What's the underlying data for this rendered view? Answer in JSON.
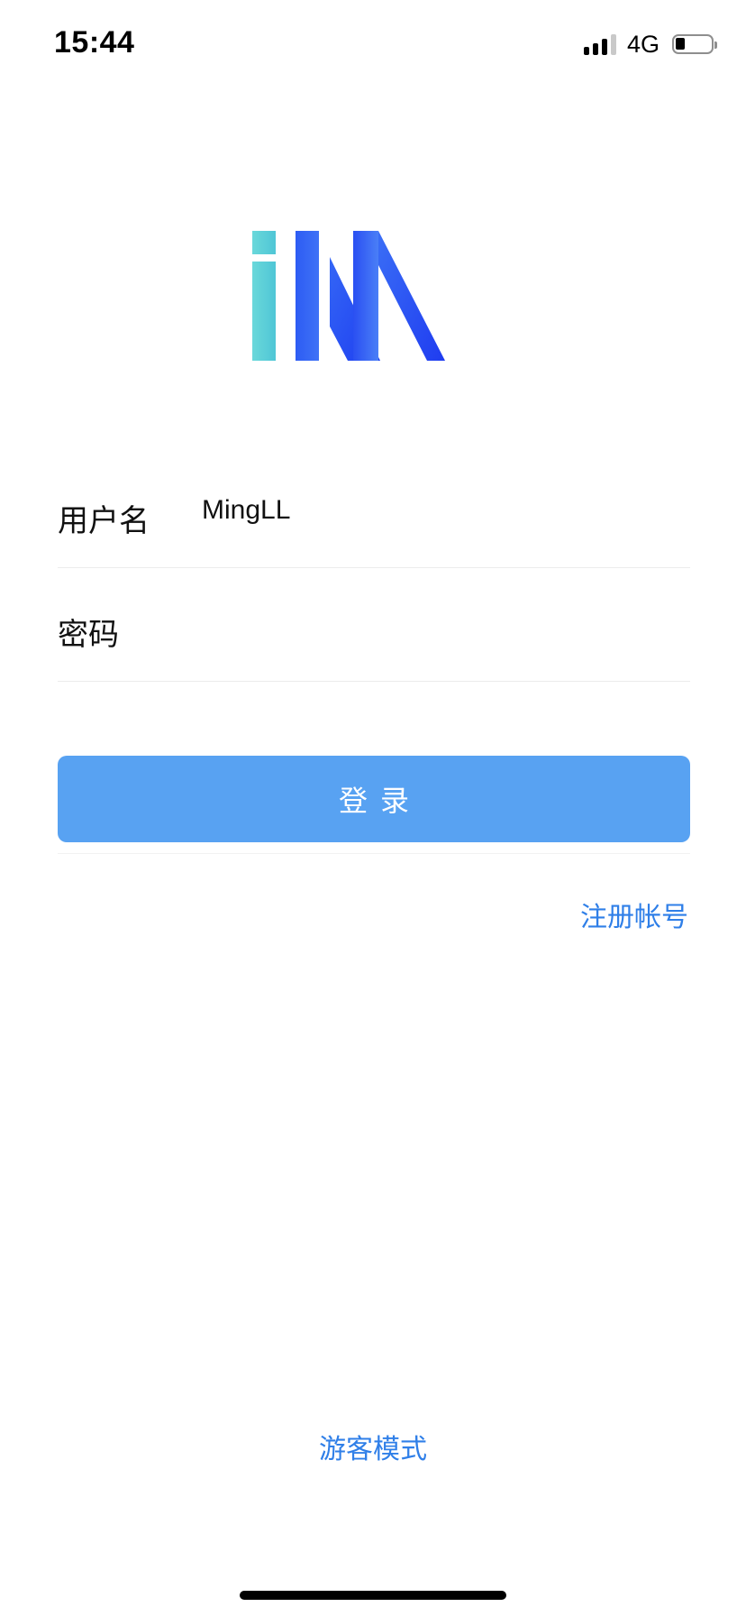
{
  "status_bar": {
    "time": "15:44",
    "network": "4G",
    "signal_bars_active": 3,
    "signal_bars_total": 4,
    "battery_level": 0.2
  },
  "logo": {
    "text": "iM",
    "colors": {
      "teal": "#5fd3d8",
      "blue": "#2f5cf5",
      "deep_blue": "#1f3ff0"
    }
  },
  "form": {
    "username": {
      "label": "用户名",
      "value": "MingLL",
      "placeholder": ""
    },
    "password": {
      "label": "密码",
      "value": "",
      "placeholder": ""
    }
  },
  "actions": {
    "login_label": "登录",
    "register_label": "注册帐号",
    "guest_label": "游客模式"
  },
  "colors": {
    "button_bg": "#58a2f2",
    "link": "#2f7fe8",
    "divider": "#ececec"
  }
}
